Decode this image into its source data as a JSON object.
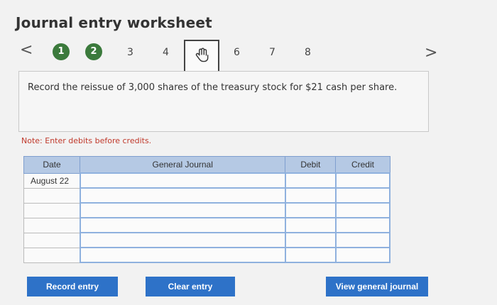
{
  "title": "Journal entry worksheet",
  "nav": {
    "prev_symbol": "<",
    "next_symbol": ">",
    "steps": [
      "1",
      "2",
      "3",
      "4",
      "5",
      "6",
      "7",
      "8"
    ]
  },
  "prompt": "Record the reissue of 3,000 shares of the treasury stock for $21 cash per share.",
  "note": "Note: Enter debits before credits.",
  "table": {
    "headers": [
      "Date",
      "General Journal",
      "Debit",
      "Credit"
    ],
    "rows": [
      [
        "August 22",
        "",
        "",
        ""
      ],
      [
        "",
        "",
        "",
        ""
      ],
      [
        "",
        "",
        "",
        ""
      ],
      [
        "",
        "",
        "",
        ""
      ],
      [
        "",
        "",
        "",
        ""
      ],
      [
        "",
        "",
        "",
        ""
      ]
    ]
  },
  "buttons": {
    "record": "Record entry",
    "clear": "Clear entry",
    "view": "View general journal"
  },
  "colors": {
    "step_done": "#3b7a3c",
    "header_bg": "#b5c9e4",
    "button": "#2e72c8",
    "note": "#c0392b"
  }
}
